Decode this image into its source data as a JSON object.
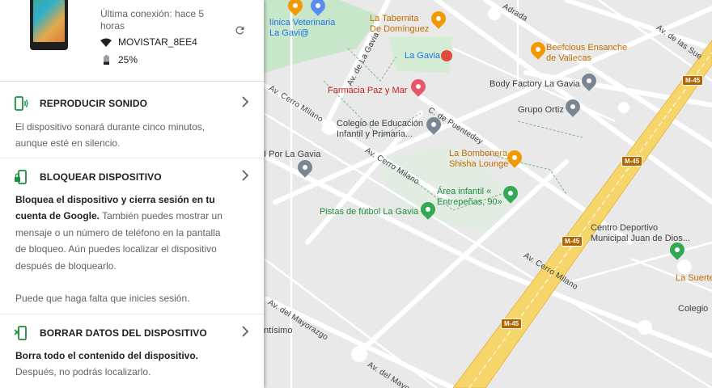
{
  "colors": {
    "accent_green": "#1e8e3e",
    "text_primary": "#202124",
    "text_secondary": "#5f6368",
    "highway_yellow": "#f6d66a",
    "park_green": "#c8e6c9"
  },
  "device": {
    "last_connection": "Última conexión: hace 5 horas",
    "wifi_icon": "wifi-icon",
    "network": "MOVISTAR_8EE4",
    "battery_icon": "battery-icon",
    "battery": "25%",
    "refresh_icon": "refresh-icon"
  },
  "actions": [
    {
      "icon": "phone-ring-icon",
      "title": "REPRODUCIR SONIDO",
      "desc_plain": "El dispositivo sonará durante cinco minutos, aunque esté en silencio."
    },
    {
      "icon": "phone-lock-icon",
      "title": "BLOQUEAR DISPOSITIVO",
      "desc_bold": "Bloquea el dispositivo y cierra sesión en tu cuenta de Google.",
      "desc_plain": " También puedes mostrar un mensaje o un número de teléfono en la pantalla de bloqueo. Aún puedes localizar el dispositivo después de bloquearlo.",
      "note": "Puede que haga falta que inicies sesión."
    },
    {
      "icon": "phone-erase-icon",
      "title": "BORRAR DATOS DEL DISPOSITIVO",
      "desc_bold": "Borra todo el contenido del dispositivo.",
      "desc_plain": "Después, no podrás localizarlo."
    }
  ],
  "map": {
    "places": {
      "clinica": "línica Veterinaria\nLa Gavi@",
      "taberna": "La Tabernita\nDe Domínguez",
      "la_gavia_metro": "La Gavia",
      "beefcious": "Beefcious Ensanche\nde Vallecas",
      "farmacia": "Farmacia Paz y Mar",
      "body_factory": "Body Factory La Gavia",
      "grupo_ortiz": "Grupo Ortiz",
      "colegio_educacion": "Colegio de Educación\nInfantil y Primaria...",
      "bombonera": "La Bombonera\nShisha Lounge",
      "area_infantil": "Área infantil «\nEntrepeñas, 90»",
      "pistas": "Pistas de fútbol La Gavia",
      "centro_deportivo": "Centro Deportivo\nMunicipal Juan de Dios...",
      "la_suerte": "La Suerte",
      "colegio": "Colegio",
      "por_la_gavia": "I Por La Gavia",
      "ntisimo": "ntísimo"
    },
    "streets": {
      "adrada": "Adrada",
      "las_suertes": "Av. de las Sue",
      "la_gavia_av": "Av. de La Gavia",
      "cerro_milano_1": "Av. Cerro Milano",
      "cerro_milano_2": "Av. Cerro Milano",
      "cerro_milano_3": "Av. Cerro Milano",
      "puentedey": "C. de Puentedey",
      "mayorazgo_1": "Av. del Mayorazgo",
      "mayorazgo_2": "Av. del Mayorazgo"
    },
    "highway": "M-45"
  }
}
